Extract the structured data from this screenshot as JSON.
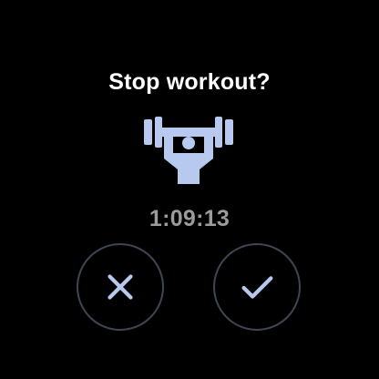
{
  "dialog": {
    "title": "Stop workout?",
    "elapsed_time": "1:09:13",
    "workout_icon": "weightlifting-icon",
    "cancel_icon": "close-icon",
    "confirm_icon": "check-icon"
  },
  "colors": {
    "background": "#000000",
    "title_text": "#ffffff",
    "timer_text": "#9b9b9b",
    "icon_accent": "#b8c9f0",
    "button_border": "#3f4652"
  }
}
